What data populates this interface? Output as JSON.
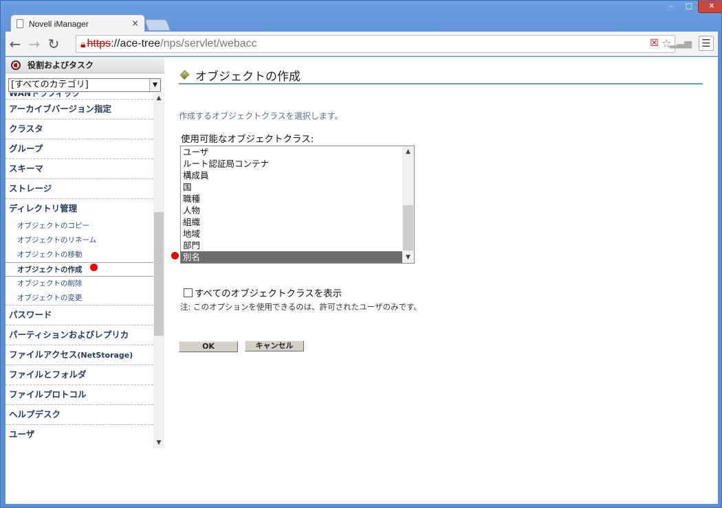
{
  "browser": {
    "window_controls": {
      "minimize": "–",
      "maximize": "□",
      "close": "✕"
    },
    "tab_title": "Novell iManager",
    "tab_close": "×",
    "url_scheme": "https",
    "url_host": "://ace-tree",
    "url_path": "/nps/servlet/webacc"
  },
  "sidebar": {
    "header": "役割およびタスク",
    "category_select": "[すべてのカテゴリ]",
    "partial_item": "WANトラフィック",
    "items": [
      {
        "label": "アーカイブバージョン指定"
      },
      {
        "label": "クラスタ"
      },
      {
        "label": "グループ"
      },
      {
        "label": "スキーマ"
      },
      {
        "label": "ストレージ"
      },
      {
        "label": "ディレクトリ管理"
      }
    ],
    "subitems": [
      "オブジェクトのコピー",
      "オブジェクトのリネーム",
      "オブジェクトの移動",
      "オブジェクトの作成",
      "オブジェクトの削除",
      "オブジェクトの変更"
    ],
    "items_after": [
      {
        "label": "パスワード"
      },
      {
        "label": "パーティションおよびレプリカ"
      },
      {
        "label": "ファイルアクセス",
        "suffix": "(NetStorage)"
      },
      {
        "label": "ファイルとフォルダ"
      },
      {
        "label": "ファイルプロトコル"
      },
      {
        "label": "ヘルプデスク"
      },
      {
        "label": "ユーザ"
      }
    ],
    "active_subitem": "オブジェクトの作成"
  },
  "main": {
    "title": "オブジェクトの作成",
    "instruction": "作成するオブジェクトクラスを選択します。",
    "available_label": "使用可能なオブジェクトクラス:",
    "object_classes": [
      "ユーザ",
      "ルート認証局コンテナ",
      "構成員",
      "国",
      "職種",
      "人物",
      "組織",
      "地域",
      "部門",
      "別名"
    ],
    "selected_class": "別名",
    "show_all_label": "すべてのオブジェクトクラスを表示",
    "show_all_checked": false,
    "note": "注: このオプションを使用できるのは、許可されたユーザのみです。",
    "ok_label": "OK",
    "cancel_label": "キャンセル"
  },
  "colors": {
    "marker": "#e00000",
    "selected_row": "#6d6d6d",
    "title_rule": "#6f96b8"
  }
}
